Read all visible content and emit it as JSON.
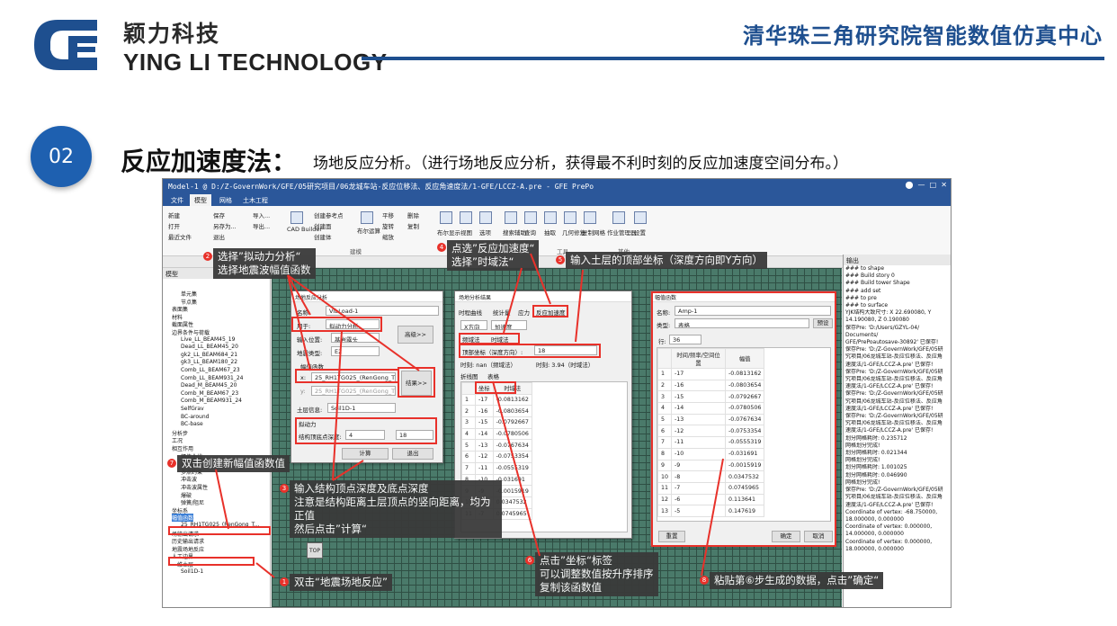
{
  "header": {
    "company_cn": "颖力科技",
    "company_en": "YING LI TECHNOLOGY",
    "center": "清华珠三角研究院智能数值仿真中心"
  },
  "section": {
    "number": "02",
    "title": "反应加速度法：",
    "desc": "场地反应分析。（进行场地反应分析，获得最不利时刻的反应加速度空间分布。）"
  },
  "app": {
    "title": "Model-1 @ D:/Z-GovernWork/GFE/05研究项目/06龙城车站-反应位移法、反应角速度法/1-GFE/LCCZ-A.pre - GFE PrePo",
    "tabs": [
      "文件",
      "模型",
      "网格",
      "土木工程"
    ],
    "ribbon": {
      "new": "新建",
      "open": "打开",
      "recent": "最近文件",
      "save": "保存",
      "save_as": "另存为...",
      "exit": "退出",
      "import": "导入...",
      "export": "导出...",
      "cad": "CAD Builder",
      "ref_point": "创建参考点",
      "create_face": "创建面",
      "create_solid": "创建体",
      "bool": "布尔运算",
      "translate": "平移",
      "rotate": "旋转",
      "scale": "缩放",
      "delete": "删除",
      "copy": "复制",
      "bool_show": "布尔显示",
      "view": "视图",
      "measure": "选项",
      "search": "搜索辅助",
      "query": "查询",
      "pick": "抽取",
      "geo_repair": "几何修复",
      "copy_mesh": "复制网格",
      "job_mgr": "作业管理器",
      "settings": "设置",
      "group_mesh": "建模",
      "group_tools": "工具",
      "group_other": "其他"
    },
    "tree_header": "模型",
    "tree": [
      "单元集",
      "节点集",
      "表面集",
      "材料",
      "截面属性",
      "边界条件与荷载",
      "Live_LL_BEAM45_19",
      "Dead_LL_BEAM45_20",
      "gk2_LL_BEAM684_21",
      "gk3_LL_BEAM180_22",
      "Comb_LL_BEAM67_23",
      "Comb_LL_BEAM931_24",
      "Dead_M_BEAM45_20",
      "Comb_M_BEAM67_23",
      "Comb_M_BEAM931_24",
      "SelfGrav",
      "BC-around",
      "BC-base",
      "分析步",
      "工况",
      "相互作用",
      "幅值曲线",
      "谱函数",
      "多点约束",
      "冲击波",
      "冲击波属性",
      "爆破",
      "弹簧/阻尼",
      "坐标系",
      "幅值函数",
      "25_RH1TG025_(RenGong_T...",
      "场输出请求",
      "历史输出请求",
      "地震场地反应",
      "人工边界",
      "一维土层",
      "Soil1D-1"
    ],
    "output_header": "输出",
    "output": [
      "### to shape",
      "### Build story 0",
      "### Build tower Shape",
      "",
      "### add set",
      "### to pre",
      "### to surface",
      "YJK结构大致尺寸: X 22.690080, Y",
      "14.190080, Z 0.190080",
      "保存Pre: 'D:/Users/GZYL-04/",
      "Documents/",
      "GFE/PrePoautosave-30892' 已保存!",
      "保存Pre: 'D:/Z-GovernWork/GFE/05研",
      "究项目/06龙城车站-反应位移法、反应角",
      "速度法/1-GFE/LCCZ-A.pre' 已保存!",
      "保存Pre: 'D:/Z-GovernWork/GFE/05研",
      "究项目/06龙城车站-反应位移法、反应角",
      "速度法/1-GFE/LCCZ-A.pre' 已保存!",
      "",
      "",
      "保存Pre: 'D:/Z-GovernWork/GFE/05研",
      "究项目/06龙城车站-反应位移法、反应角",
      "速度法/1-GFE/LCCZ-A.pre' 已保存!",
      "保存Pre: 'D:/Z-GovernWork/GFE/05研",
      "究项目/06龙城车站-反应位移法、反应角",
      "速度法/1-GFE/LCCZ-A.pre' 已保存!",
      "划分网格耗时: 0.235712",
      "网格划分完成!",
      "划分网格耗时: 0.021344",
      "网格划分完成!",
      "划分网格耗时: 1.001025",
      "划分网格耗时: 0.046990",
      "网格划分完成!",
      "保存Pre: 'D:/Z-GovernWork/GFE/05研",
      "究项目/06龙城车站-反应位移法、反应角",
      "速度法/1-GFE/LCCZ-A.pre' 已保存!",
      "Coordinate of vertex: -68.750000,",
      "18.000000, 0.000000",
      "Coordinate of vertex: 0.000000,",
      "14.000000, 0.000000",
      "Coordinate of vertex: 0.000000,",
      "18.000000, 0.000000"
    ]
  },
  "dlg1": {
    "title": "场地反应分析",
    "name_label": "名称:",
    "name": "VibLoad-1",
    "use_label": "用于:",
    "use": "拟动力分析",
    "input_label": "输入位置:",
    "input": "基岩露头",
    "type_label": "地震类型:",
    "type": "E2",
    "amp_label": "幅值函数",
    "x_label": "x:",
    "x_val": "25_RH1TG025_(RenGong_T",
    "y_label": "y:",
    "y_val": "25_RH1TG025_(RenGong_T",
    "soil_label": "土层信息:",
    "soil": "Soil1D-1",
    "dyn_label": "拟动力",
    "depth_label": "结构顶底点深度:",
    "top": "4",
    "bottom": "18",
    "compute": "计算",
    "exit": "退出",
    "advanced": "高级>>",
    "result": "结果>>"
  },
  "dlg2": {
    "title": "场地分析结果",
    "tabs": [
      "时程曲线",
      "统计量",
      "应力",
      "反应加速度"
    ],
    "dir": "X方向",
    "qty": "加速度",
    "freq": "频域法",
    "time": "时域法",
    "top_label": "顶部坐标（深度方向）:",
    "top_val": "18",
    "time_label": "时刻: nan（频域法）",
    "time2": "时刻: 3.94（时域法）",
    "sub_tabs": [
      "折线图",
      "表格"
    ],
    "col1": "坐标",
    "col2": "时域法",
    "rows": [
      [
        "1",
        "-17",
        "-0.0813162"
      ],
      [
        "2",
        "-16",
        "-0.0803654"
      ],
      [
        "3",
        "-15",
        "-0.0792667"
      ],
      [
        "4",
        "-14",
        "-0.0780506"
      ],
      [
        "5",
        "-13",
        "-0.0767634"
      ],
      [
        "6",
        "-12",
        "-0.0753354"
      ],
      [
        "7",
        "-11",
        "-0.0555319"
      ],
      [
        "8",
        "-10",
        "-0.031691"
      ],
      [
        "9",
        "-9",
        "-0.0015919"
      ],
      [
        "10",
        "-8",
        "0.0347532"
      ],
      [
        "11",
        "-7",
        "0.0745965"
      ]
    ]
  },
  "dlg3": {
    "title": "幅值函数",
    "name_label": "名称:",
    "name": "Amp-1",
    "type_label": "类型:",
    "type": "表格",
    "preset": "预设",
    "rows_label": "行:",
    "rows_val": "36",
    "col1": "时间/频率/空间位置",
    "col2": "幅值",
    "rows": [
      [
        "1",
        "-17",
        "-0.0813162"
      ],
      [
        "2",
        "-16",
        "-0.0803654"
      ],
      [
        "3",
        "-15",
        "-0.0792667"
      ],
      [
        "4",
        "-14",
        "-0.0780506"
      ],
      [
        "5",
        "-13",
        "-0.0767634"
      ],
      [
        "6",
        "-12",
        "-0.0753354"
      ],
      [
        "7",
        "-11",
        "-0.0555319"
      ],
      [
        "8",
        "-10",
        "-0.031691"
      ],
      [
        "9",
        "-9",
        "-0.0015919"
      ],
      [
        "10",
        "-8",
        "0.0347532"
      ],
      [
        "11",
        "-7",
        "0.0745965"
      ],
      [
        "12",
        "-6",
        "0.113641"
      ],
      [
        "13",
        "-5",
        "0.147619"
      ]
    ],
    "reset": "重置",
    "ok": "确定",
    "cancel": "取消"
  },
  "callouts": {
    "c1": "双击“地震场地反应”",
    "c2a": "选择”拟动力分析“",
    "c2b": "选择地震波幅值函数",
    "c3a": "输入结构顶点深度及底点深度",
    "c3b": "注意是结构距离土层顶点的竖向距离，均为正值",
    "c3c": "然后点击”计算“",
    "c4a": "点选”反应加速度“",
    "c4b": "选择”时域法“",
    "c5": "输入土层的顶部坐标（深度方向即Y方向）",
    "c6a": "点击”坐标“标签",
    "c6b": "可以调整数值按升序排序",
    "c6c": "复制该函数值",
    "c7": "双击创建新幅值函数值",
    "c8": "粘贴第⑥步生成的数据，点击”确定“"
  },
  "colors": {
    "brand": "#1e4f8f",
    "badge": "#1e60b0",
    "highlight": "#e8312a"
  }
}
